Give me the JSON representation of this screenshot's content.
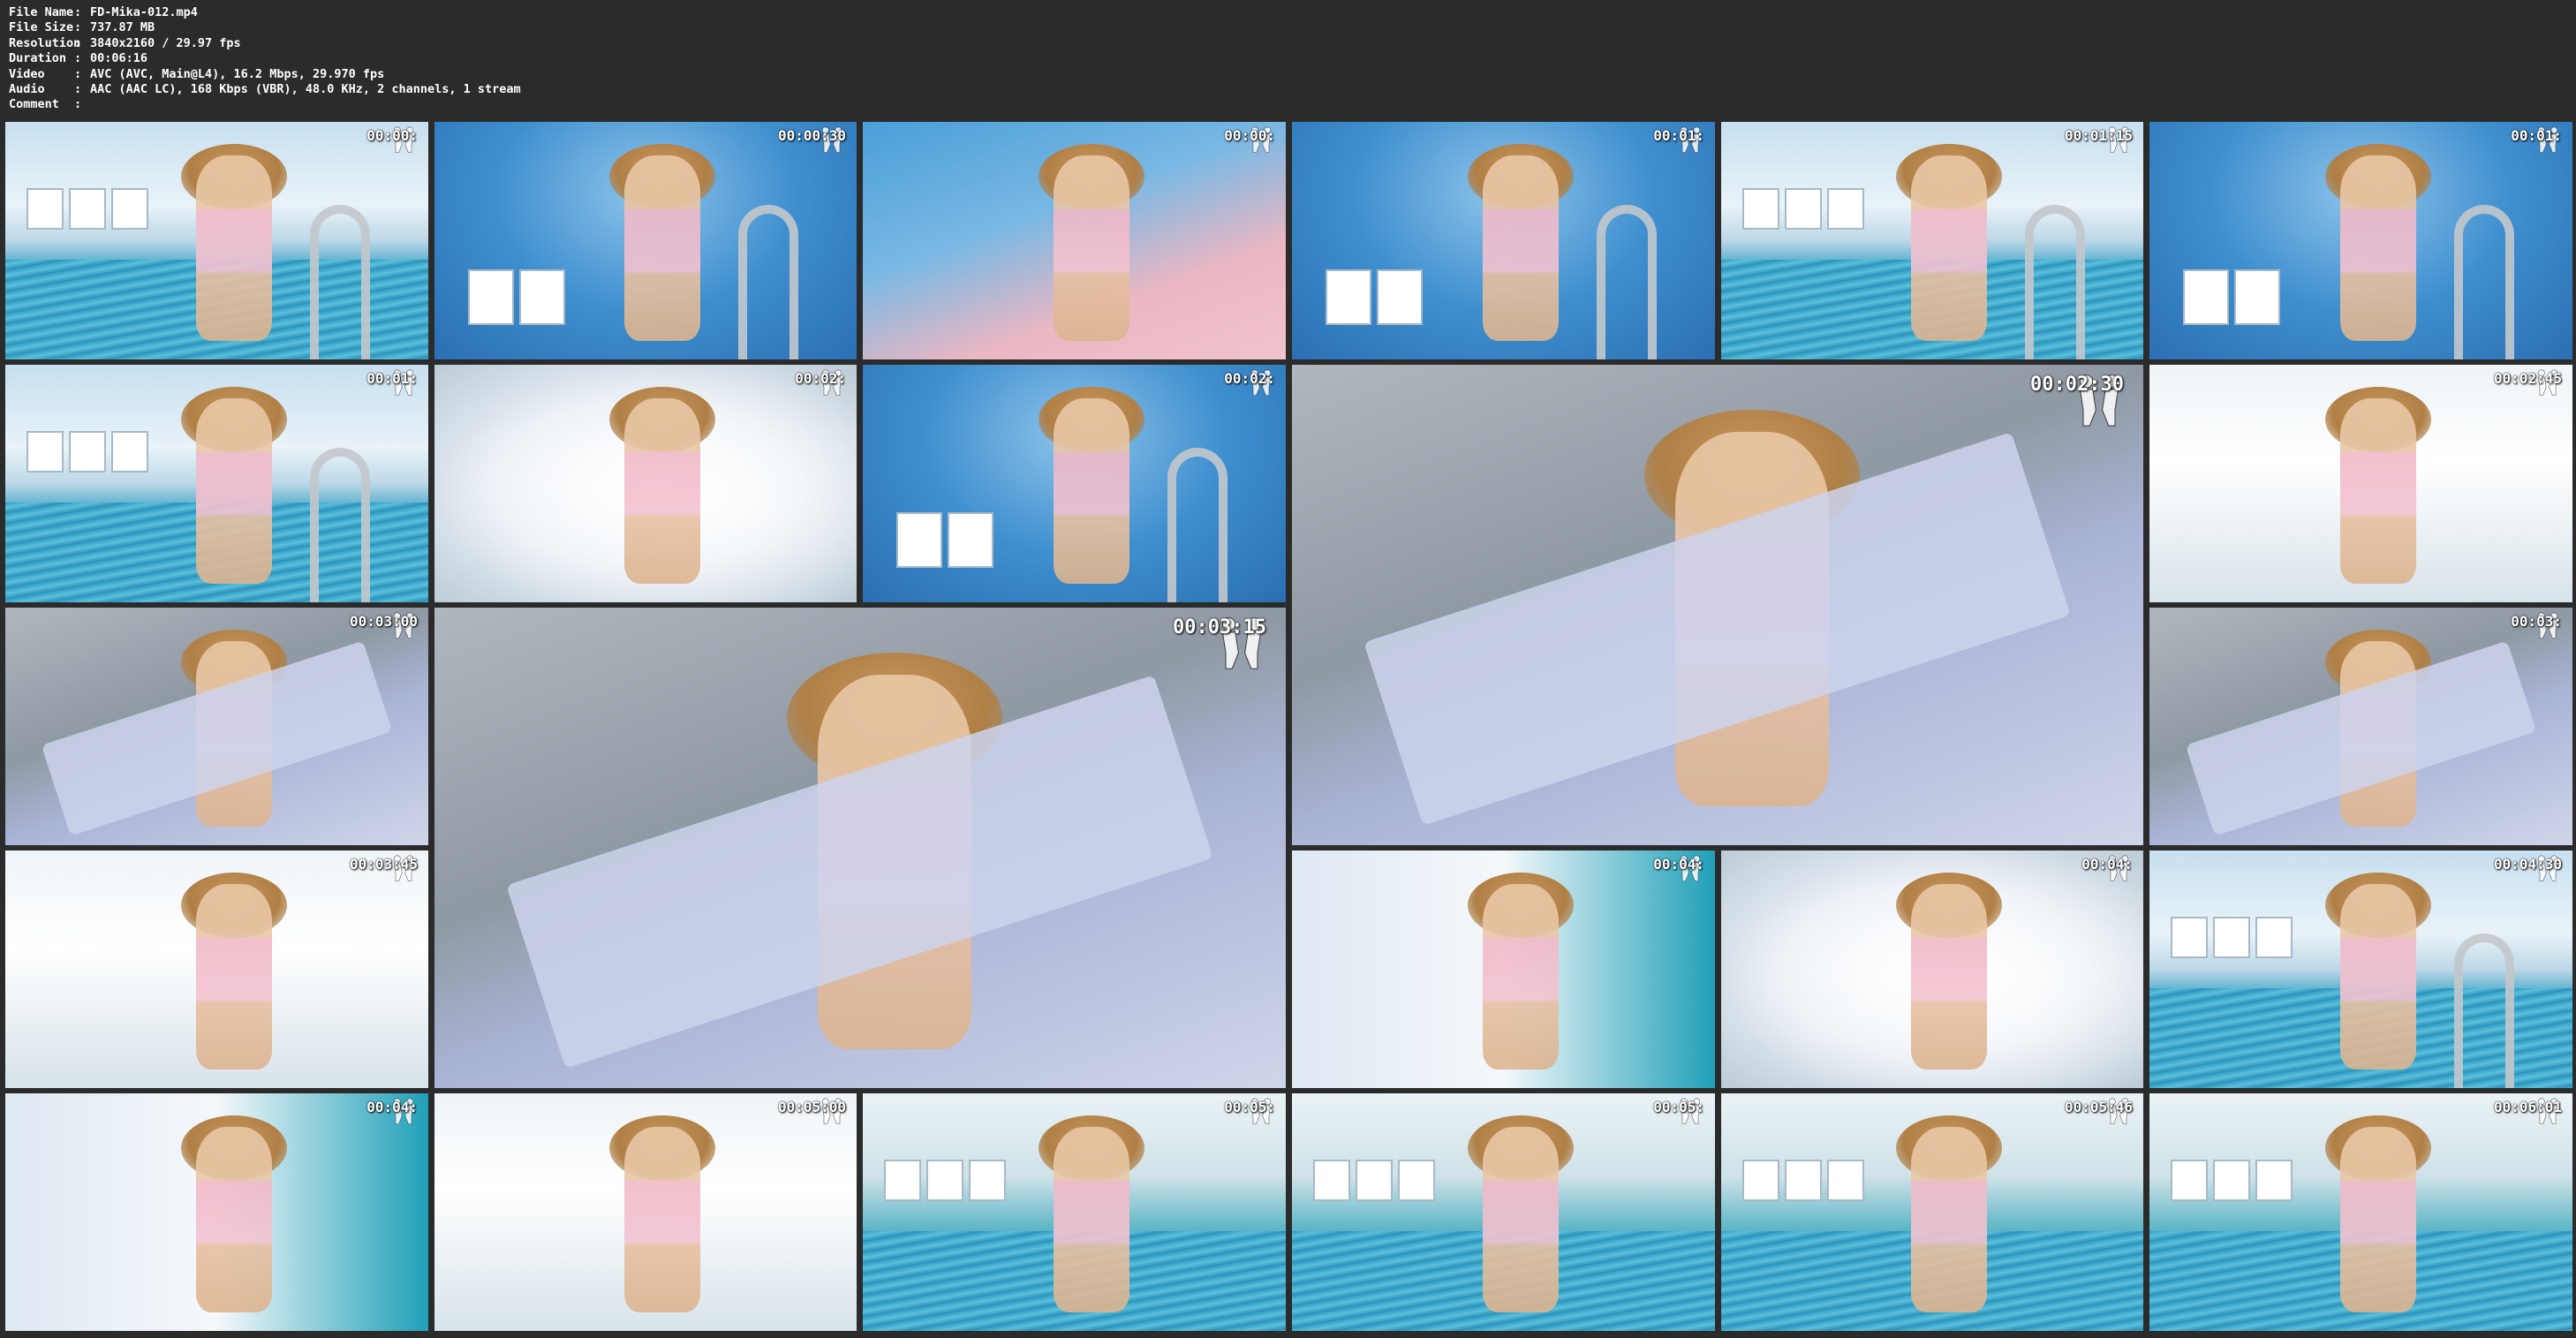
{
  "info": {
    "rows": [
      {
        "label": "File Name",
        "value": "FD-Mika-012.mp4"
      },
      {
        "label": "File Size",
        "value": "737.87 MB"
      },
      {
        "label": "Resolution",
        "value": "3840x2160 / 29.97 fps"
      },
      {
        "label": "Duration",
        "value": "00:06:16"
      },
      {
        "label": "Video",
        "value": "AVC (AVC, Main@L4), 16.2 Mbps, 29.970 fps"
      },
      {
        "label": "Audio",
        "value": "AAC (AAC LC), 168 Kbps (VBR), 48.0 KHz, 2 channels, 1 stream"
      },
      {
        "label": "Comment",
        "value": ""
      }
    ]
  },
  "thumbnails": [
    {
      "ts": "00:00:",
      "scene": "pool-wide"
    },
    {
      "ts": "00:00:30",
      "scene": "ceiling"
    },
    {
      "ts": "00:00:",
      "scene": "closeup"
    },
    {
      "ts": "00:01:",
      "scene": "ceiling"
    },
    {
      "ts": "00:01:15",
      "scene": "pool-wide"
    },
    {
      "ts": "00:01:",
      "scene": "ceiling"
    },
    {
      "ts": "00:01:",
      "scene": "pool-wide"
    },
    {
      "ts": "00:02:",
      "scene": "haze"
    },
    {
      "ts": "00:02:",
      "scene": "ceiling"
    },
    {
      "ts": "00:02:30",
      "scene": "lounger"
    },
    {
      "ts": "00:02:45",
      "scene": "window"
    },
    {
      "ts": "00:03:00",
      "scene": "lounger"
    },
    {
      "ts": "00:03:15",
      "scene": "lounger"
    },
    {
      "ts": "00:03:",
      "scene": "lounger"
    },
    {
      "ts": "00:03:45",
      "scene": "window"
    },
    {
      "ts": "00:04:",
      "scene": "tile-blue"
    },
    {
      "ts": "00:04:",
      "scene": "haze"
    },
    {
      "ts": "00:04:30",
      "scene": "pool-wide"
    },
    {
      "ts": "00:04:",
      "scene": "tile-blue"
    },
    {
      "ts": "00:05:00",
      "scene": "window"
    },
    {
      "ts": "00:05:",
      "scene": "poolside"
    },
    {
      "ts": "00:05:",
      "scene": "poolside"
    },
    {
      "ts": "00:05:46",
      "scene": "poolside"
    },
    {
      "ts": "00:06:01",
      "scene": "poolside"
    }
  ]
}
